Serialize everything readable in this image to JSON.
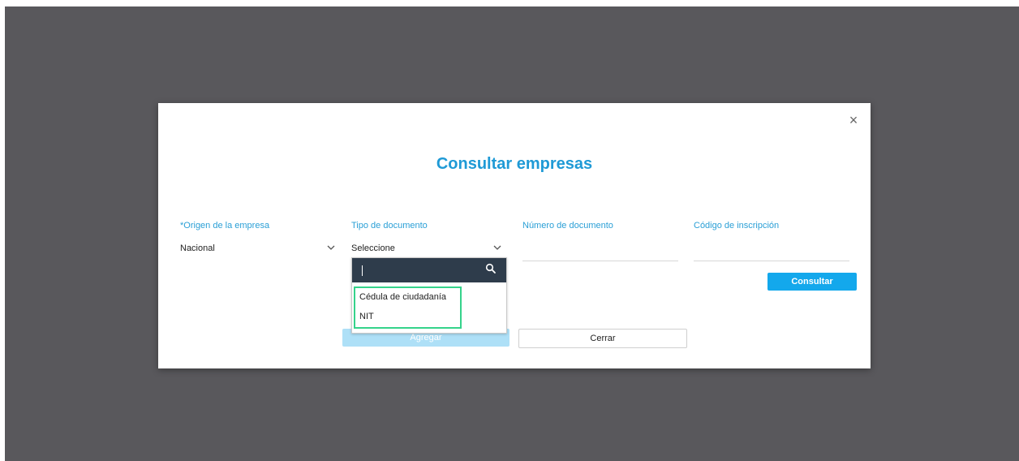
{
  "modal": {
    "title": "Consultar empresas",
    "close_label": "×"
  },
  "fields": {
    "origen": {
      "label": "*Origen de la empresa",
      "value": "Nacional"
    },
    "tipo": {
      "label": "Tipo de documento",
      "value": "Seleccione"
    },
    "numero": {
      "label": "Número de documento",
      "value": ""
    },
    "codigo": {
      "label": "Código de inscripción",
      "value": ""
    }
  },
  "dropdown": {
    "search_value": "",
    "options": [
      "Cédula de ciudadanía",
      "NIT"
    ]
  },
  "buttons": {
    "consultar": "Consultar",
    "agregar": "Agregar",
    "cerrar": "Cerrar"
  },
  "colors": {
    "backdrop": "#59585c",
    "accent": "#1f9ad6",
    "highlight": "#35d38b",
    "dropdown_header": "#2e3c4b"
  }
}
